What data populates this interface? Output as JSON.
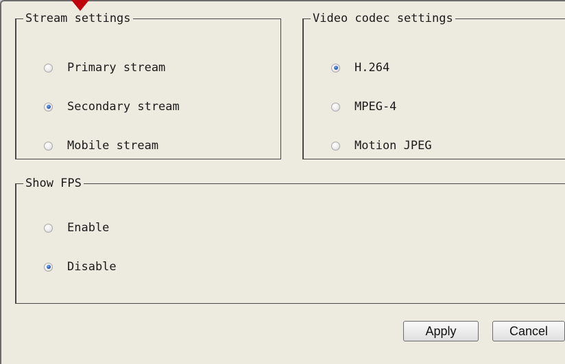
{
  "stream_settings": {
    "legend": "Stream settings",
    "options": [
      {
        "label": "Primary stream",
        "checked": false
      },
      {
        "label": "Secondary stream",
        "checked": true
      },
      {
        "label": "Mobile stream",
        "checked": false
      }
    ]
  },
  "codec_settings": {
    "legend": "Video codec settings",
    "options": [
      {
        "label": "H.264",
        "checked": true
      },
      {
        "label": "MPEG-4",
        "checked": false
      },
      {
        "label": "Motion JPEG",
        "checked": false
      }
    ]
  },
  "fps": {
    "legend": "Show FPS",
    "options": [
      {
        "label": "Enable",
        "checked": false
      },
      {
        "label": "Disable",
        "checked": true
      }
    ]
  },
  "buttons": {
    "apply": "Apply",
    "cancel": "Cancel"
  },
  "colors": {
    "panel_background": "#edeae0",
    "radio_selected": "#2a5fb4",
    "annotation_arrow": "#c0000b"
  },
  "icons": {
    "annotation": "red-arrow-icon"
  }
}
